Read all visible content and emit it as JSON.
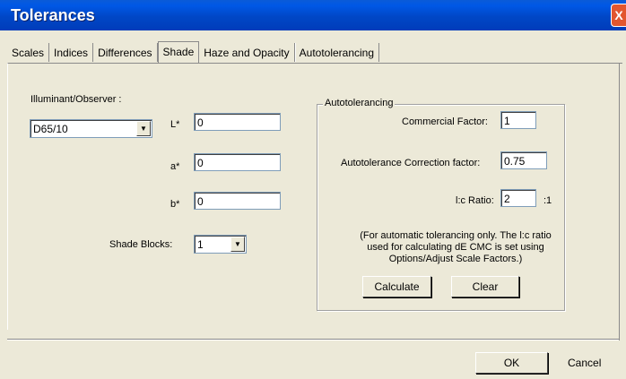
{
  "window": {
    "title": "Tolerances",
    "close_glyph": "X"
  },
  "tabs": [
    {
      "label": "Scales"
    },
    {
      "label": "Indices"
    },
    {
      "label": "Differences"
    },
    {
      "label": "Shade",
      "active": true
    },
    {
      "label": "Haze and Opacity"
    },
    {
      "label": "Autotolerancing"
    }
  ],
  "shade": {
    "illuminant_label": "Illuminant/Observer :",
    "illuminant_value": "D65/10",
    "L_label": "L*",
    "L_value": "0",
    "a_label": "a*",
    "a_value": "0",
    "b_label": "b*",
    "b_value": "0",
    "shade_blocks_label": "Shade Blocks:",
    "shade_blocks_value": "1"
  },
  "autotolerancing": {
    "group_title": "Autotolerancing",
    "commercial_factor_label": "Commercial Factor:",
    "commercial_factor_value": "1",
    "correction_factor_label": "Autotolerance Correction factor:",
    "correction_factor_value": "0.75",
    "lc_ratio_label": "l:c Ratio:",
    "lc_ratio_value": "2",
    "lc_ratio_suffix": ":1",
    "note": "(For automatic tolerancing only.  The l:c ratio used for calculating dE CMC is set using Options/Adjust Scale Factors.)",
    "calculate_label": "Calculate",
    "clear_label": "Clear"
  },
  "footer": {
    "ok_label": "OK",
    "cancel_label": "Cancel"
  },
  "icons": {
    "dropdown": "chevron-down-icon",
    "close": "close-icon"
  }
}
